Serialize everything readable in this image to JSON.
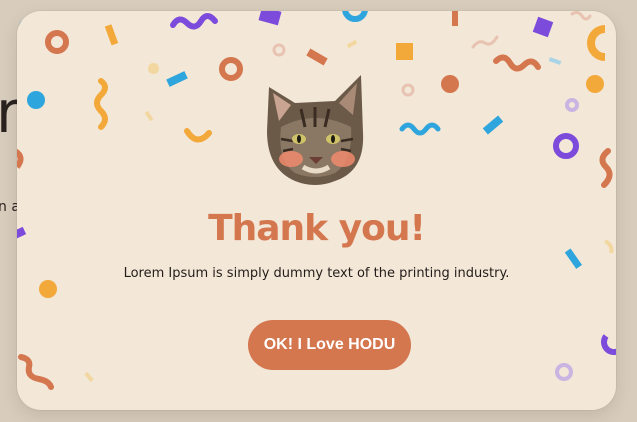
{
  "background": {
    "color": "#d8ccbc",
    "partial_heading": "r",
    "partial_text": "n a"
  },
  "modal": {
    "background_color": "#f3e7d8",
    "title": "Thank you!",
    "message": "Lorem Ipsum is simply dummy text of the printing industry.",
    "ok_button_label": "OK! I Love HODU",
    "image": "cat-face",
    "colors": {
      "accent": "#d4764e",
      "button_text": "#ffffff",
      "text": "#231d19"
    }
  },
  "confetti_palette": [
    "#d4764e",
    "#f3a83a",
    "#2ea5dc",
    "#7d4bdc",
    "#e8c3b2",
    "#c9b4e2",
    "#f2d8a0",
    "#a8d4e6"
  ]
}
